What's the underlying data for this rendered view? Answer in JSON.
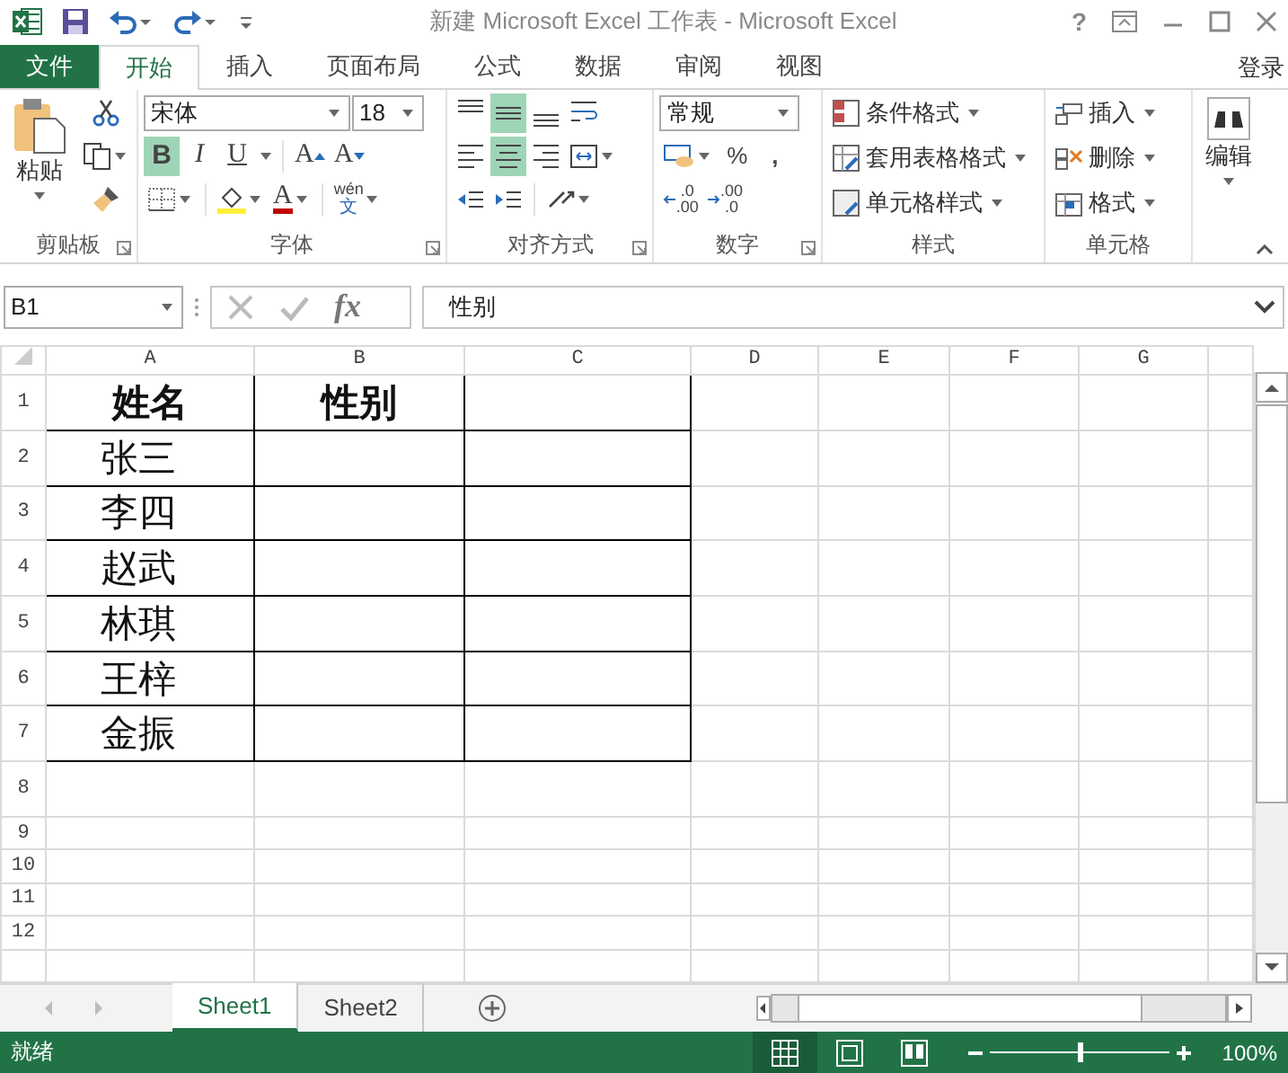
{
  "title_bar": {
    "title": "新建 Microsoft Excel 工作表 - Microsoft Excel",
    "help": "?"
  },
  "ribbon_tabs": [
    {
      "label": "文件",
      "kind": "file",
      "selected": false
    },
    {
      "label": "开始",
      "kind": "tab",
      "selected": true
    },
    {
      "label": "插入",
      "kind": "tab",
      "selected": false
    },
    {
      "label": "页面布局",
      "kind": "tab",
      "selected": false
    },
    {
      "label": "公式",
      "kind": "tab",
      "selected": false
    },
    {
      "label": "数据",
      "kind": "tab",
      "selected": false
    },
    {
      "label": "审阅",
      "kind": "tab",
      "selected": false
    },
    {
      "label": "视图",
      "kind": "tab",
      "selected": false
    }
  ],
  "sign_in": "登录",
  "clipboard": {
    "paste": "粘贴",
    "name": "剪贴板"
  },
  "font": {
    "family": "宋体",
    "size": "18",
    "name": "字体",
    "style_buttons": [
      {
        "label": "B",
        "kind": "bold",
        "on": true
      },
      {
        "label": "I",
        "kind": "italic",
        "on": false
      },
      {
        "label": "U",
        "kind": "underline",
        "on": false
      }
    ],
    "size_buttons": [
      {
        "label": "A",
        "kind": "grow"
      },
      {
        "label": "A",
        "kind": "shrink"
      }
    ],
    "font_color": "A",
    "phonetic_top": "wén",
    "phonetic_bottom": "文"
  },
  "alignment": {
    "vertical": [
      {
        "kind": "top",
        "selected": false
      },
      {
        "kind": "middle",
        "selected": true
      },
      {
        "kind": "bottom",
        "selected": false
      }
    ],
    "horizontal": [
      {
        "kind": "left",
        "selected": false
      },
      {
        "kind": "center",
        "selected": true
      },
      {
        "kind": "right",
        "selected": false
      }
    ],
    "name": "对齐方式"
  },
  "number": {
    "format": "常规",
    "percent": "%",
    "comma": ",",
    "decimals": [
      {
        "top": ".0",
        "bottom": ".00"
      },
      {
        "top": ".00",
        "bottom": ".0"
      }
    ],
    "name": "数字"
  },
  "styles": {
    "items": [
      "条件格式",
      "套用表格格式",
      "单元格样式"
    ],
    "name": "样式"
  },
  "cells": {
    "items": [
      "插入",
      "删除",
      "格式"
    ],
    "name": "单元格"
  },
  "editing": {
    "label": "编辑"
  },
  "formula_bar": {
    "name_box": "B1",
    "fx": "fx",
    "value": "性别"
  },
  "sheet": {
    "columns": [
      "A",
      "B",
      "C",
      "D",
      "E",
      "F",
      "G"
    ],
    "rows": [
      {
        "label": "1",
        "cells": [
          "姓名",
          "性别",
          ""
        ]
      },
      {
        "label": "2",
        "cells": [
          "张三",
          "",
          ""
        ]
      },
      {
        "label": "3",
        "cells": [
          "李四",
          "",
          ""
        ]
      },
      {
        "label": "4",
        "cells": [
          "赵武",
          "",
          ""
        ]
      },
      {
        "label": "5",
        "cells": [
          "林琪",
          "",
          ""
        ]
      },
      {
        "label": "6",
        "cells": [
          "王梓",
          "",
          ""
        ]
      },
      {
        "label": "7",
        "cells": [
          "金振",
          "",
          ""
        ]
      },
      {
        "label": "8",
        "cells": []
      },
      {
        "label": "9",
        "cells": []
      },
      {
        "label": "10",
        "cells": []
      },
      {
        "label": "11",
        "cells": []
      },
      {
        "label": "12",
        "cells": []
      }
    ]
  },
  "sheet_tabs": [
    {
      "label": "Sheet1",
      "selected": true
    },
    {
      "label": "Sheet2",
      "selected": false
    }
  ],
  "status_bar": {
    "status": "就绪",
    "views": [
      {
        "kind": "normal",
        "selected": true
      },
      {
        "kind": "page_layout",
        "selected": false
      },
      {
        "kind": "page_break",
        "selected": false
      }
    ],
    "zoom": {
      "level": 0.5
    },
    "zoom_text": "100%"
  }
}
